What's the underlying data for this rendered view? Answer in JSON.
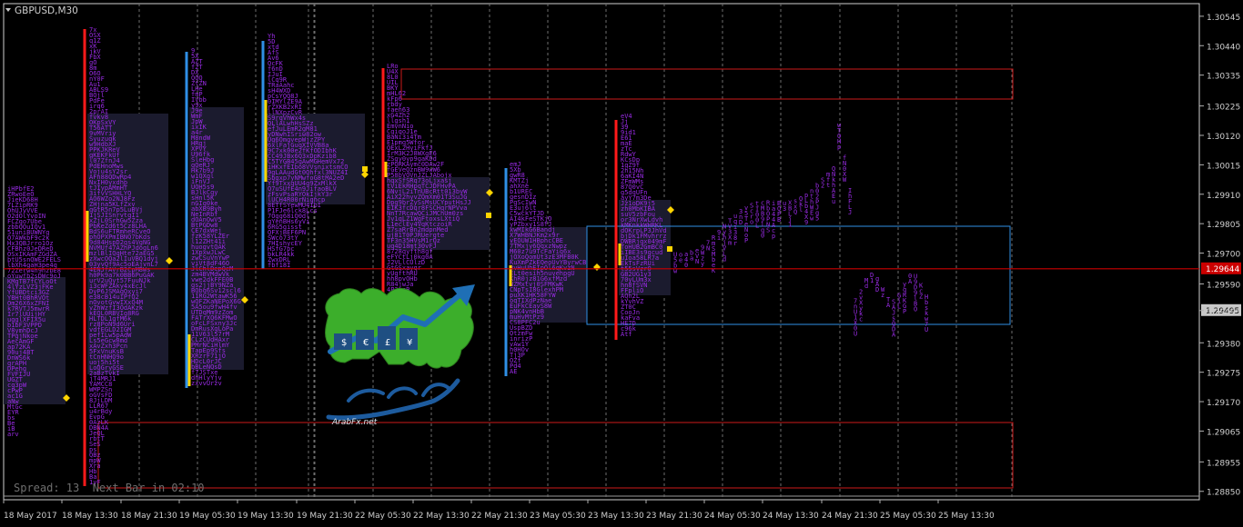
{
  "window": {
    "symbol_label": "GBPUSD,M30",
    "dropdown_icon": "triangle-down-icon"
  },
  "footer": {
    "spread_label": "Spread: 13  Next Bar in 02:10"
  },
  "price_axis": {
    "current_price": "1.29644",
    "current_price_color": "#cc0000",
    "bid_marker_price": "1.29495"
  },
  "colors": {
    "background": "#000000",
    "grid_dashed": "#6e6e6e",
    "axis_line": "#cfcfcf",
    "profile_letters": "#9a2be6",
    "value_area_fill": "#1b1b2e",
    "poc_marker": "#ffd400",
    "red_range_box": "#cc1a1a",
    "blue_range_box": "#2f8fe6",
    "red_vertical": "#ff1a1a",
    "blue_vertical": "#2f8fe6",
    "current_price_line": "#cc0000"
  },
  "chart_data": {
    "type": "market-profile",
    "symbol": "GBPUSD",
    "timeframe": "M30",
    "y_ticks": [
      "1.30545",
      "1.30440",
      "1.30335",
      "1.30225",
      "1.30120",
      "1.30015",
      "1.29910",
      "1.29805",
      "1.29700",
      "1.29590",
      "1.29495",
      "1.29380",
      "1.29275",
      "1.29170",
      "1.29065",
      "1.28955",
      "1.28850"
    ],
    "x_ticks": [
      "18 May 2017",
      "18 May 13:30",
      "18 May 21:30",
      "19 May 05:30",
      "19 May 13:30",
      "19 May 21:30",
      "22 May 05:30",
      "22 May 13:30",
      "22 May 21:30",
      "23 May 05:30",
      "23 May 13:30",
      "23 May 21:30",
      "24 May 05:30",
      "24 May 13:30",
      "24 May 21:30",
      "25 May 05:30",
      "25 May 13:30"
    ],
    "ylim": [
      1.2882,
      1.3059
    ],
    "current_price": 1.29644,
    "sessions": [
      {
        "low": 1.29,
        "high": 1.2988,
        "poc": 1.2918
      },
      {
        "low": 1.2885,
        "high": 1.3045,
        "poc": 1.2966
      },
      {
        "low": 1.2922,
        "high": 1.304,
        "poc": 1.295
      },
      {
        "low": 1.2963,
        "high": 1.3043,
        "poc": 1.2998
      },
      {
        "low": 1.295,
        "high": 1.303,
        "poc": 1.2996
      },
      {
        "low": 1.293,
        "high": 1.3003,
        "poc": 1.2964
      },
      {
        "low": 1.2944,
        "high": 1.3016,
        "poc": 1.2971
      }
    ]
  }
}
